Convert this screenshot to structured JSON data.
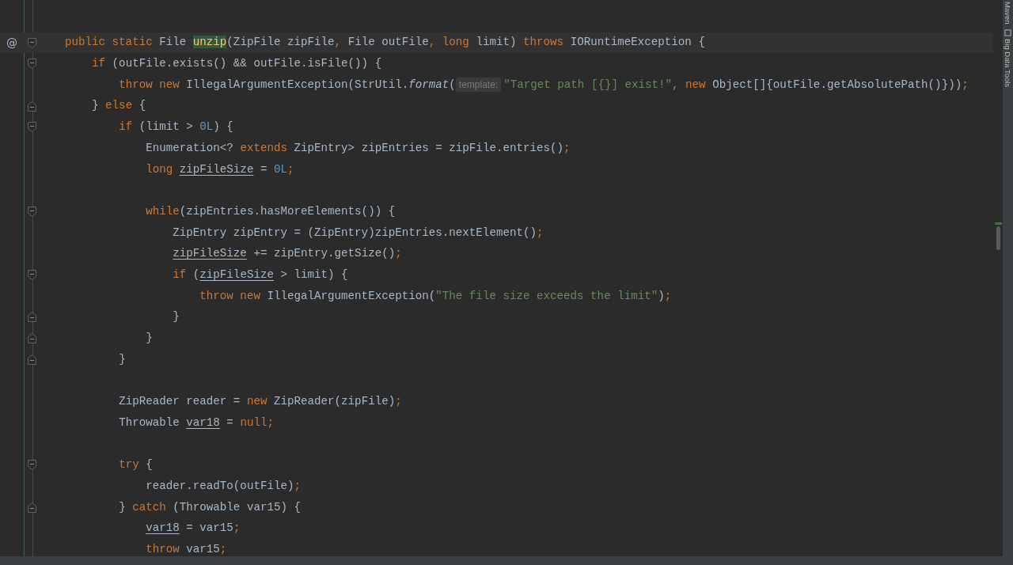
{
  "editor": {
    "lines": [
      {
        "current": false
      },
      {
        "current": true,
        "gutter_mark": "@",
        "fold_marker": {
          "kind": "start"
        },
        "tokens": [
          {
            "kind": "keyword",
            "text": "public static "
          },
          {
            "kind": "plain",
            "text": "File "
          },
          {
            "kind": "declaration",
            "text": "unzip"
          },
          {
            "kind": "plain",
            "text": "(ZipFile zipFile"
          },
          {
            "kind": "keyword",
            "text": ", "
          },
          {
            "kind": "plain",
            "text": "File outFile"
          },
          {
            "kind": "keyword",
            "text": ", long "
          },
          {
            "kind": "plain",
            "text": "limit) "
          },
          {
            "kind": "keyword",
            "text": "throws "
          },
          {
            "kind": "plain",
            "text": "IORuntimeException {"
          }
        ]
      },
      {
        "current": false,
        "fold_marker": {
          "kind": "start"
        },
        "tokens": [
          {
            "kind": "keyword",
            "text": "    if "
          },
          {
            "kind": "plain",
            "text": "(outFile.exists() && outFile.isFile()) {"
          }
        ]
      },
      {
        "current": false,
        "tokens": [
          {
            "kind": "keyword",
            "text": "        throw new "
          },
          {
            "kind": "plain",
            "text": "IllegalArgumentException(StrUtil."
          },
          {
            "kind": "static-call",
            "text": "format"
          },
          {
            "kind": "plain",
            "text": "("
          },
          {
            "kind": "hint",
            "text": "template:"
          },
          {
            "kind": "string",
            "text": "\"Target path [{}] exist!\""
          },
          {
            "kind": "keyword",
            "text": ", new "
          },
          {
            "kind": "plain",
            "text": "Object[]{outFile.getAbsolutePath()}))"
          },
          {
            "kind": "keyword",
            "text": ";"
          }
        ]
      },
      {
        "current": false,
        "fold_marker": {
          "kind": "end"
        },
        "tokens": [
          {
            "kind": "plain",
            "text": "    } "
          },
          {
            "kind": "keyword",
            "text": "else "
          },
          {
            "kind": "plain",
            "text": "{"
          }
        ]
      },
      {
        "current": false,
        "fold_marker": {
          "kind": "start"
        },
        "tokens": [
          {
            "kind": "keyword",
            "text": "        if "
          },
          {
            "kind": "plain",
            "text": "(limit > "
          },
          {
            "kind": "number",
            "text": "0L"
          },
          {
            "kind": "plain",
            "text": ") {"
          }
        ]
      },
      {
        "current": false,
        "tokens": [
          {
            "kind": "plain",
            "text": "            Enumeration<? "
          },
          {
            "kind": "keyword",
            "text": "extends "
          },
          {
            "kind": "plain",
            "text": "ZipEntry> zipEntries = zipFile.entries()"
          },
          {
            "kind": "keyword",
            "text": ";"
          }
        ]
      },
      {
        "current": false,
        "tokens": [
          {
            "kind": "keyword",
            "text": "            long "
          },
          {
            "kind": "reassigned",
            "text": "zipFileSize"
          },
          {
            "kind": "plain",
            "text": " = "
          },
          {
            "kind": "number",
            "text": "0L"
          },
          {
            "kind": "keyword",
            "text": ";"
          }
        ]
      },
      {
        "current": false
      },
      {
        "current": false,
        "fold_marker": {
          "kind": "start"
        },
        "tokens": [
          {
            "kind": "keyword",
            "text": "            while"
          },
          {
            "kind": "plain",
            "text": "(zipEntries.hasMoreElements()) {"
          }
        ]
      },
      {
        "current": false,
        "tokens": [
          {
            "kind": "plain",
            "text": "                ZipEntry zipEntry = (ZipEntry)zipEntries.nextElement()"
          },
          {
            "kind": "keyword",
            "text": ";"
          }
        ]
      },
      {
        "current": false,
        "tokens": [
          {
            "kind": "reassigned",
            "text": "                zipFileSize"
          },
          {
            "kind": "plain",
            "text": " += zipEntry.getSize()"
          },
          {
            "kind": "keyword",
            "text": ";"
          }
        ]
      },
      {
        "current": false,
        "fold_marker": {
          "kind": "start"
        },
        "tokens": [
          {
            "kind": "keyword",
            "text": "                if "
          },
          {
            "kind": "plain",
            "text": "("
          },
          {
            "kind": "reassigned",
            "text": "zipFileSize"
          },
          {
            "kind": "plain",
            "text": " > limit) {"
          }
        ]
      },
      {
        "current": false,
        "tokens": [
          {
            "kind": "keyword",
            "text": "                    throw new "
          },
          {
            "kind": "plain",
            "text": "IllegalArgumentException("
          },
          {
            "kind": "string",
            "text": "\"The file size exceeds the limit\""
          },
          {
            "kind": "plain",
            "text": ")"
          },
          {
            "kind": "keyword",
            "text": ";"
          }
        ]
      },
      {
        "current": false,
        "fold_marker": {
          "kind": "end"
        },
        "tokens": [
          {
            "kind": "plain",
            "text": "                }"
          }
        ]
      },
      {
        "current": false,
        "fold_marker": {
          "kind": "end"
        },
        "tokens": [
          {
            "kind": "plain",
            "text": "            }"
          }
        ]
      },
      {
        "current": false,
        "fold_marker": {
          "kind": "end"
        },
        "tokens": [
          {
            "kind": "plain",
            "text": "        }"
          }
        ]
      },
      {
        "current": false
      },
      {
        "current": false,
        "tokens": [
          {
            "kind": "plain",
            "text": "        ZipReader reader = "
          },
          {
            "kind": "keyword",
            "text": "new "
          },
          {
            "kind": "plain",
            "text": "ZipReader(zipFile)"
          },
          {
            "kind": "keyword",
            "text": ";"
          }
        ]
      },
      {
        "current": false,
        "tokens": [
          {
            "kind": "plain",
            "text": "        Throwable "
          },
          {
            "kind": "reassigned",
            "text": "var18"
          },
          {
            "kind": "plain",
            "text": " = "
          },
          {
            "kind": "keyword",
            "text": "null;"
          }
        ]
      },
      {
        "current": false
      },
      {
        "current": false,
        "fold_marker": {
          "kind": "start"
        },
        "tokens": [
          {
            "kind": "keyword",
            "text": "        try "
          },
          {
            "kind": "plain",
            "text": "{"
          }
        ]
      },
      {
        "current": false,
        "tokens": [
          {
            "kind": "plain",
            "text": "            reader.readTo(outFile)"
          },
          {
            "kind": "keyword",
            "text": ";"
          }
        ]
      },
      {
        "current": false,
        "fold_marker": {
          "kind": "end"
        },
        "tokens": [
          {
            "kind": "plain",
            "text": "        } "
          },
          {
            "kind": "keyword",
            "text": "catch "
          },
          {
            "kind": "plain",
            "text": "(Throwable var15) {"
          }
        ]
      },
      {
        "current": false,
        "tokens": [
          {
            "kind": "reassigned",
            "text": "            var18"
          },
          {
            "kind": "plain",
            "text": " = var15"
          },
          {
            "kind": "keyword",
            "text": ";"
          }
        ]
      },
      {
        "current": false,
        "tokens": [
          {
            "kind": "keyword",
            "text": "            throw "
          },
          {
            "kind": "plain",
            "text": "var15"
          },
          {
            "kind": "keyword",
            "text": ";"
          }
        ]
      }
    ]
  },
  "tool_window_strip": [
    {
      "kind": "text",
      "label": "Maven"
    },
    {
      "kind": "with-icon",
      "label": "Big Data Tools"
    }
  ]
}
